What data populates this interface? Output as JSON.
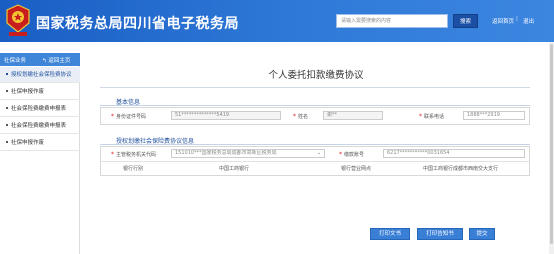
{
  "header": {
    "site_title": "国家税务总局四川省电子税务局",
    "search_placeholder": "请输入需要搜索的内容",
    "search_button": "搜索",
    "links": [
      "返回首页",
      "退出"
    ],
    "bg_color": "#2a6fcf",
    "emblem_icon": "tax-emblem-icon"
  },
  "sidebar": {
    "title": "社保业务",
    "back": "返回主页",
    "back_icon": "back-arrow-icon",
    "items": [
      {
        "label": "授权划缴社会保险费协议",
        "active": true
      },
      {
        "label": "社保申报作废",
        "active": false
      },
      {
        "label": "社会保险费缴费申报表",
        "active": false
      },
      {
        "label": "社会保险费缴费申报表",
        "active": false
      },
      {
        "label": "社保申报作废",
        "active": false
      }
    ]
  },
  "main": {
    "page_title": "个人委托扣款缴费协议",
    "basic_info": {
      "section_title": "基本信息",
      "id_type_label": "身份证件号码",
      "id_value": "51**************5419",
      "name_label": "姓名",
      "name_value": "谢**",
      "phone_label": "联系电话",
      "phone_value": "1888***2919"
    },
    "agreement": {
      "section_title": "授权划缴社会保险费协议信息",
      "authority_label": "主管税务机关代码",
      "authority_value": "151010***国家税务总局成都市高新区税务局",
      "account_label": "缴款账号",
      "account_value": "6217***********0031654",
      "bank_type_label": "银行行别",
      "bank_type_value": "中国工商银行",
      "branch_label": "银行营业网点",
      "branch_value": "中国工商银行成都市西南交大支行"
    },
    "buttons": {
      "print_text": "打印文书",
      "print_notice": "打印告知书",
      "submit": "提交"
    }
  }
}
